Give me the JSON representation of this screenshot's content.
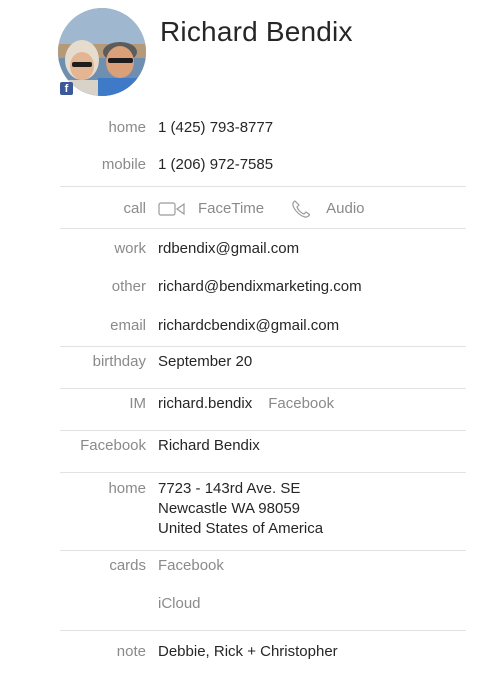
{
  "contact": {
    "name": "Richard Bendix",
    "avatar_badge": "f",
    "avatar_badge_color": "#3b5998"
  },
  "fields": {
    "home_phone": {
      "label": "home",
      "value": "1 (425) 793-8777"
    },
    "mobile_phone": {
      "label": "mobile",
      "value": "1 (206) 972-7585"
    },
    "call": {
      "label": "call",
      "options": [
        {
          "label": "FaceTime",
          "icon": "video-camera-icon"
        },
        {
          "label": "Audio",
          "icon": "phone-icon"
        }
      ]
    },
    "work_email": {
      "label": "work",
      "value": "rdbendix@gmail.com"
    },
    "other_email": {
      "label": "other",
      "value": "richard@bendixmarketing.com"
    },
    "email": {
      "label": "email",
      "value": "richardcbendix@gmail.com"
    },
    "birthday": {
      "label": "birthday",
      "value": "September 20"
    },
    "im": {
      "label": "IM",
      "value": "richard.bendix",
      "service": "Facebook"
    },
    "facebook": {
      "label": "Facebook",
      "value": "Richard Bendix"
    },
    "home_address": {
      "label": "home",
      "lines": [
        "7723 - 143rd Ave. SE",
        "Newcastle WA 98059",
        "United States of America"
      ]
    },
    "cards": {
      "label": "cards",
      "items": [
        "Facebook",
        "iCloud"
      ]
    },
    "note": {
      "label": "note",
      "value": "Debbie, Rick + Christopher"
    }
  },
  "colors": {
    "label_gray": "#8a8a8a",
    "text": "#262626",
    "divider": "#e2e2e2"
  }
}
